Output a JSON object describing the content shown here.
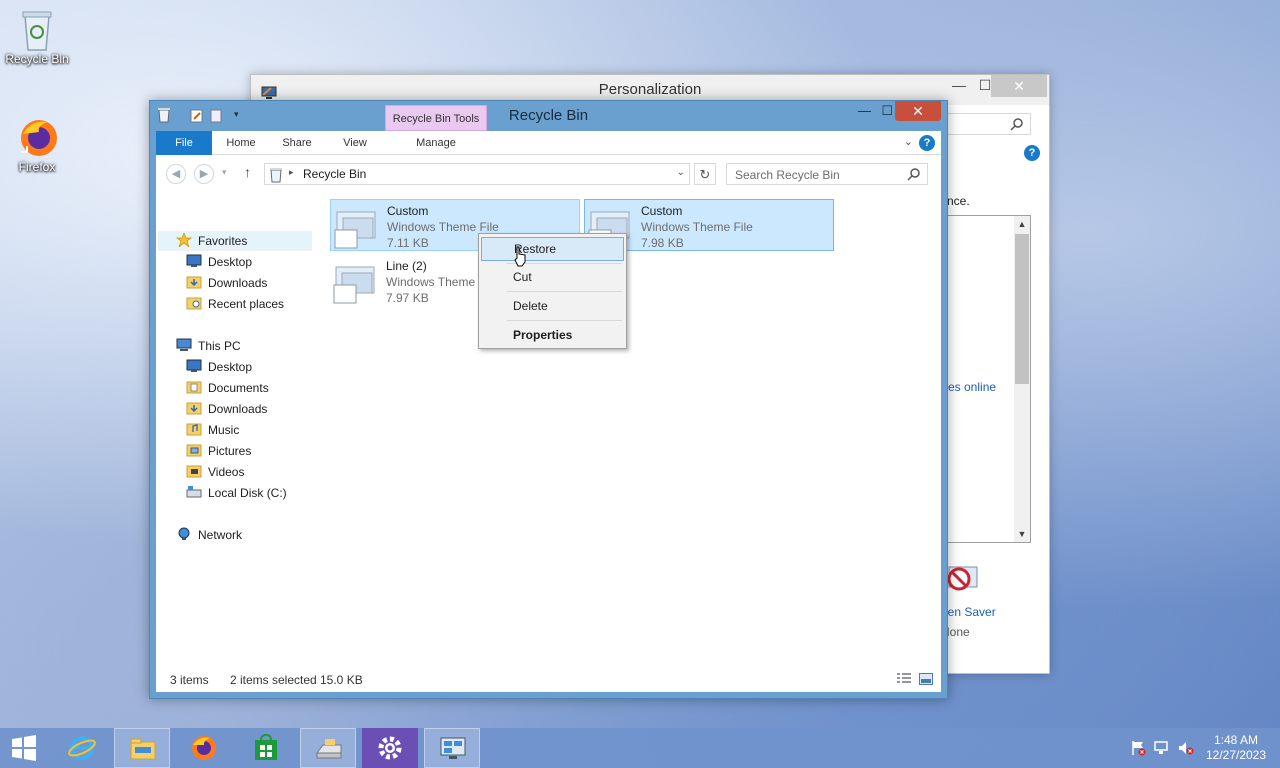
{
  "desktop": {
    "icons": [
      {
        "label": "Recycle Bin"
      },
      {
        "label": "Firefox"
      }
    ]
  },
  "personalization": {
    "title": "Personalization",
    "minimize_glyph": "—",
    "maximize_glyph": "☐",
    "close_glyph": "✕",
    "partial_text_1": "nce.",
    "partial_link": "es online",
    "screen_saver_label": "een Saver",
    "screen_saver_value": "None"
  },
  "explorer": {
    "title": "Recycle Bin",
    "tools_tab": "Recycle Bin Tools",
    "minimize_glyph": "—",
    "maximize_glyph": "☐",
    "close_glyph": "✕",
    "tabs": [
      "File",
      "Home",
      "Share",
      "View",
      "Manage"
    ],
    "address": {
      "path": "Recycle Bin"
    },
    "search": {
      "placeholder": "Search Recycle Bin"
    },
    "nav": {
      "favorites": "Favorites",
      "fav_items": [
        "Desktop",
        "Downloads",
        "Recent places"
      ],
      "this_pc": "This PC",
      "pc_items": [
        "Desktop",
        "Documents",
        "Downloads",
        "Music",
        "Pictures",
        "Videos",
        "Local Disk (C:)"
      ],
      "network": "Network"
    },
    "files": [
      {
        "name": "Custom",
        "type": "Windows Theme File",
        "size": "7.11 KB"
      },
      {
        "name": "Custom",
        "type": "Windows Theme File",
        "size": "7.98 KB"
      },
      {
        "name": "Line (2)",
        "type": "Windows Theme",
        "size": "7.97 KB"
      }
    ],
    "status": {
      "count": "3 items",
      "selected": "2 items selected",
      "size": "15.0 KB"
    }
  },
  "context_menu": {
    "items": [
      "Restore",
      "Cut",
      "Delete",
      "Properties"
    ]
  },
  "taskbar": {
    "clock_time": "1:48 AM",
    "clock_date": "12/27/2023"
  },
  "colors": {
    "file_tab": "#1979ca",
    "tools_tab": "#e9c9ef",
    "selection": "#cce8ff",
    "close_button": "#c74f3c"
  }
}
